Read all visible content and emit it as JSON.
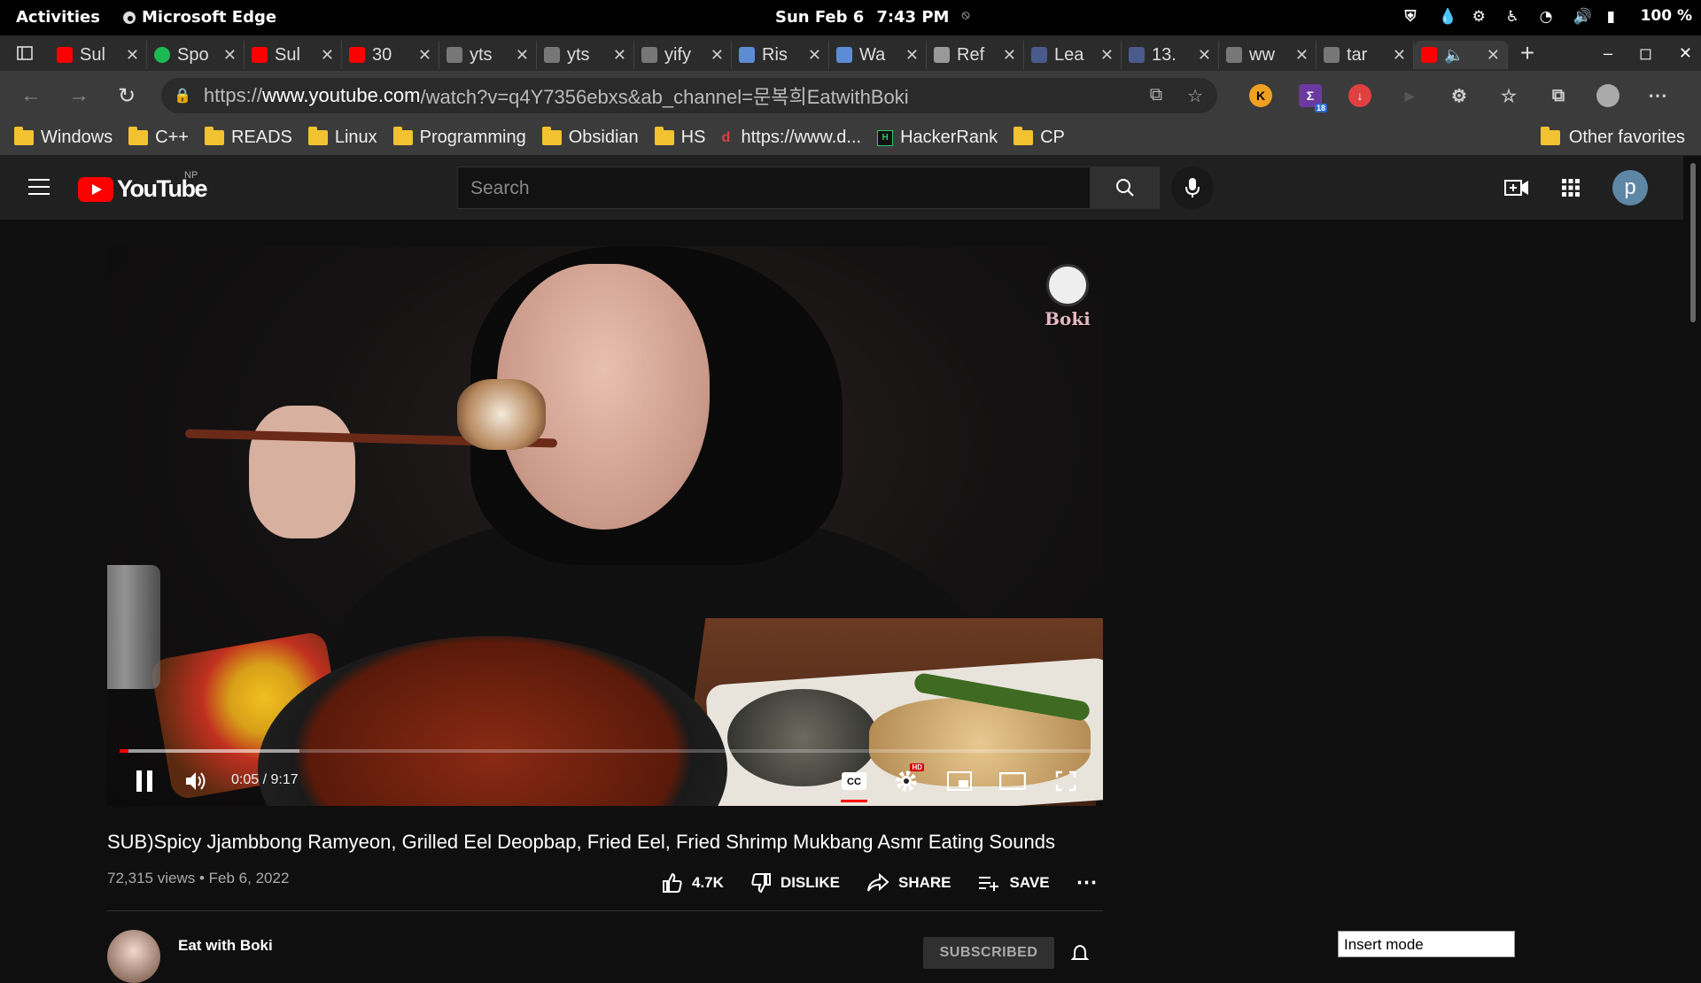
{
  "system_bar": {
    "activities": "Activities",
    "app_name": "Microsoft Edge",
    "date": "Sun Feb 6",
    "time": "7:43 PM",
    "battery": "100 %"
  },
  "tabs": [
    {
      "label": "Sul",
      "icon": "youtube",
      "color": "#ff0000"
    },
    {
      "label": "Spo",
      "icon": "spotify",
      "color": "#1db954"
    },
    {
      "label": "Sul",
      "icon": "youtube",
      "color": "#ff0000"
    },
    {
      "label": "30",
      "icon": "youtube",
      "color": "#ff0000"
    },
    {
      "label": "yts",
      "icon": "generic",
      "color": "#777777"
    },
    {
      "label": "yts",
      "icon": "generic",
      "color": "#777777"
    },
    {
      "label": "yify",
      "icon": "generic",
      "color": "#777777"
    },
    {
      "label": "Ris",
      "icon": "yc",
      "color": "#5c8cd6"
    },
    {
      "label": "Wa",
      "icon": "yc",
      "color": "#5c8cd6"
    },
    {
      "label": "Ref",
      "icon": "gh",
      "color": "#999999"
    },
    {
      "label": "Lea",
      "icon": "book",
      "color": "#4a5a8a"
    },
    {
      "label": "13.",
      "icon": "book",
      "color": "#4a5a8a"
    },
    {
      "label": "ww",
      "icon": "generic",
      "color": "#777777"
    },
    {
      "label": "tar",
      "icon": "page",
      "color": "#777777"
    }
  ],
  "active_tab": {
    "icon": "youtube",
    "color": "#ff0000"
  },
  "address": {
    "scheme": "https://",
    "host": "www.youtube.com",
    "path": "/watch?v=q4Y7356ebxs&ab_channel=문복희EatwithBoki"
  },
  "extensions": {
    "badge_count": "18"
  },
  "bookmarks": [
    "Windows",
    "C++",
    "READS",
    "Linux",
    "Programming",
    "Obsidian",
    "HS",
    "https://www.d...",
    "HackerRank",
    "CP"
  ],
  "bookmarks_other": "Other favorites",
  "youtube": {
    "logo_text": "YouTube",
    "region": "NP",
    "search_placeholder": "Search",
    "avatar_letter": "p"
  },
  "player": {
    "current_time": "0:05",
    "duration": "9:17",
    "time_display": "0:05 / 9:17",
    "played_fraction": 0.009,
    "buffered_fraction": 0.185,
    "watermark": "Boki"
  },
  "video": {
    "title": "SUB)Spicy Jjambbong Ramyeon, Grilled Eel Deopbap, Fried Eel, Fried Shrimp Mukbang Asmr Eating Sounds",
    "views": "72,315 views",
    "date": "Feb 6, 2022",
    "likes": "4.7K",
    "dislike": "DISLIKE",
    "share": "SHARE",
    "save": "SAVE"
  },
  "channel": {
    "name": "Eat with Boki",
    "subscribe_label": "SUBSCRIBED"
  },
  "vim_status": "Insert mode"
}
